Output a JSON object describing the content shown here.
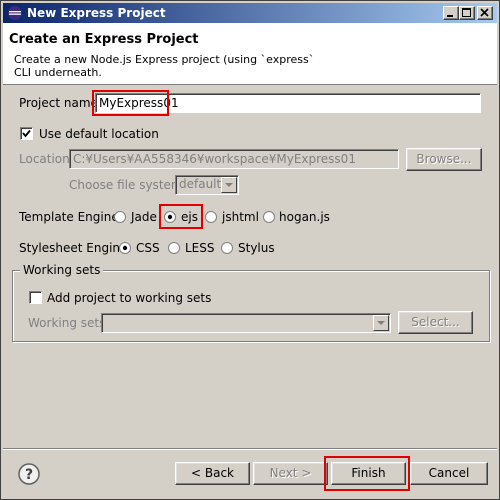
{
  "window": {
    "title": "New Express Project"
  },
  "header": {
    "title": "Create an Express Project",
    "description": "Create a new Node.js Express project (using `express` CLI underneath."
  },
  "project_name": {
    "label": "Project name:",
    "value": "MyExpress01"
  },
  "default_location": {
    "label": "Use default location",
    "checked": true
  },
  "location": {
    "label": "Location:",
    "value": "C:¥Users¥AA558346¥workspace¥MyExpress01",
    "browse_label": "Browse..."
  },
  "file_system": {
    "label": "Choose file system:",
    "value": "default"
  },
  "template_engine": {
    "label": "Template Engine:",
    "options": [
      "Jade",
      "ejs",
      "jshtml",
      "hogan.js"
    ],
    "selected": "ejs"
  },
  "stylesheet_engine": {
    "label": "Stylesheet Engine:",
    "options": [
      "CSS",
      "LESS",
      "Stylus"
    ],
    "selected": "CSS"
  },
  "working_sets": {
    "group_title": "Working sets",
    "add_label": "Add project to working sets",
    "add_checked": false,
    "sets_label": "Working sets:",
    "sets_value": "",
    "select_label": "Select..."
  },
  "footer": {
    "back_label": "< Back",
    "next_label": "Next >",
    "finish_label": "Finish",
    "cancel_label": "Cancel"
  },
  "colors": {
    "highlight": "#e00000",
    "titlebar_start": "#0a246a",
    "titlebar_end": "#a6caf0"
  }
}
